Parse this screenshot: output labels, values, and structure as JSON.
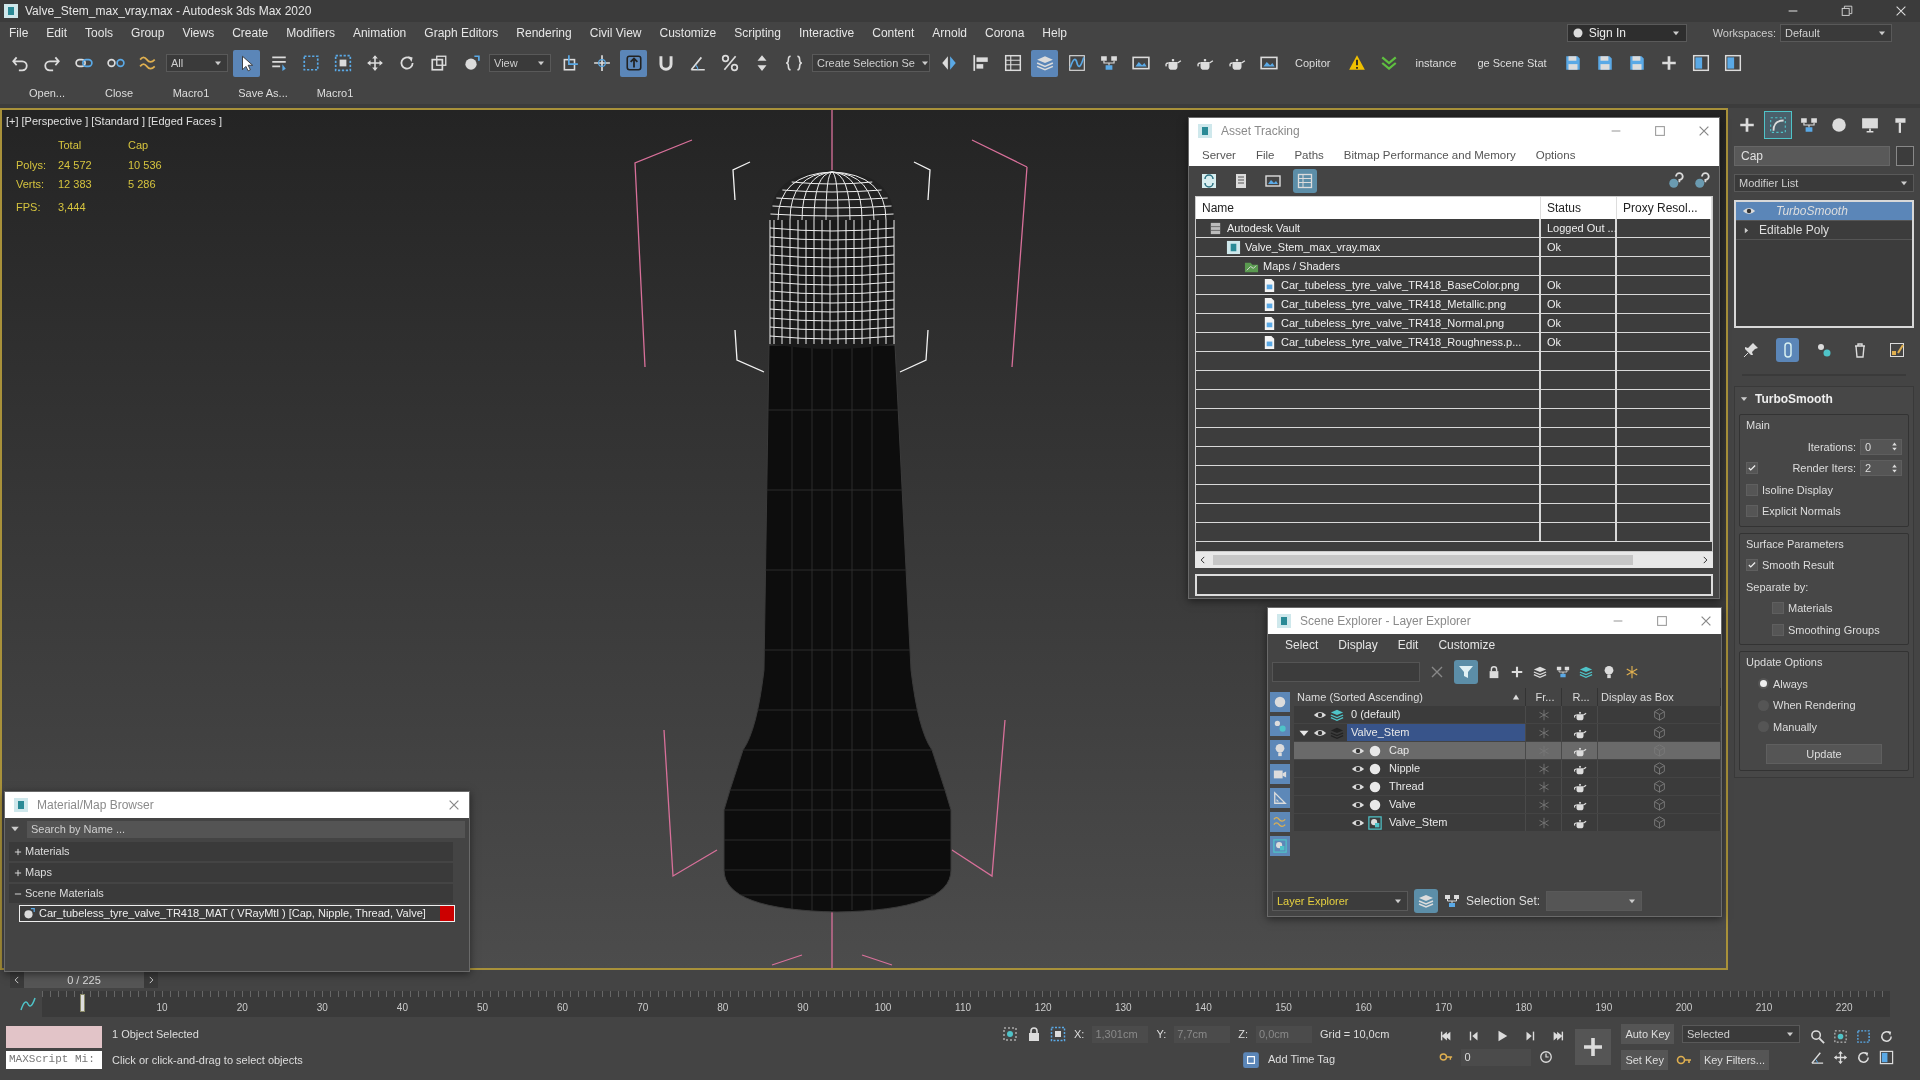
{
  "window": {
    "title": "Valve_Stem_max_vray.max - Autodesk 3ds Max 2020"
  },
  "menu": [
    "File",
    "Edit",
    "Tools",
    "Group",
    "Views",
    "Create",
    "Modifiers",
    "Animation",
    "Graph Editors",
    "Rendering",
    "Civil View",
    "Customize",
    "Scripting",
    "Interactive",
    "Content",
    "Arnold",
    "Corona",
    "Help"
  ],
  "account": {
    "sign_in": "Sign In",
    "workspaces_label": "Workspaces:",
    "workspace": "Default"
  },
  "toolbar": [
    {
      "kind": "button",
      "selected": false
    },
    {
      "kind": "button",
      "selected": false
    },
    {
      "kind": "button",
      "selected": false
    },
    {
      "kind": "button",
      "selected": false
    },
    {
      "kind": "button",
      "selected": false
    },
    {
      "kind": "dropdown",
      "value": "All"
    },
    {
      "kind": "button",
      "selected": true
    },
    {
      "kind": "button",
      "selected": false
    },
    {
      "kind": "button",
      "selected": false
    },
    {
      "kind": "button",
      "selected": false
    },
    {
      "kind": "button",
      "selected": false
    },
    {
      "kind": "button",
      "selected": false
    },
    {
      "kind": "button",
      "selected": false
    },
    {
      "kind": "button",
      "selected": false
    },
    {
      "kind": "dropdown",
      "value": "View"
    },
    {
      "kind": "button",
      "selected": false
    },
    {
      "kind": "button",
      "selected": false
    },
    {
      "kind": "button",
      "selected": true
    },
    {
      "kind": "button",
      "selected": false
    },
    {
      "kind": "button",
      "selected": false
    },
    {
      "kind": "button",
      "selected": false
    },
    {
      "kind": "button",
      "selected": false
    },
    {
      "kind": "button",
      "selected": false
    },
    {
      "kind": "dropdown",
      "value": "Create Selection Se"
    },
    {
      "kind": "button",
      "selected": false
    },
    {
      "kind": "button",
      "selected": false
    },
    {
      "kind": "button",
      "selected": false
    },
    {
      "kind": "button",
      "selected": true
    },
    {
      "kind": "button",
      "selected": false
    },
    {
      "kind": "button",
      "selected": false
    },
    {
      "kind": "button",
      "selected": false
    },
    {
      "kind": "button",
      "selected": false
    },
    {
      "kind": "button",
      "selected": false
    },
    {
      "kind": "button",
      "selected": false
    },
    {
      "kind": "button",
      "selected": false
    },
    {
      "kind": "label",
      "text": "Copitor"
    },
    {
      "kind": "button",
      "selected": false
    },
    {
      "kind": "button",
      "selected": false
    },
    {
      "kind": "label",
      "text": "instance"
    },
    {
      "kind": "label",
      "text": "ge Scene Stat"
    },
    {
      "kind": "button",
      "selected": false
    },
    {
      "kind": "button",
      "selected": false
    },
    {
      "kind": "button",
      "selected": false
    },
    {
      "kind": "button",
      "selected": false
    },
    {
      "kind": "button",
      "selected": false
    },
    {
      "kind": "button",
      "selected": false
    }
  ],
  "macro_bar": [
    "Open...",
    "Close",
    "Macro1",
    "Save As...",
    "Macro1"
  ],
  "viewport": {
    "labels": [
      "[+]",
      "[Perspective ]",
      "[Standard ]",
      "[Edged Faces ]"
    ],
    "stats": {
      "columns": [
        "Total",
        "Cap"
      ],
      "rows": [
        {
          "label": "Polys:",
          "values": [
            "24 572",
            "10 536"
          ]
        },
        {
          "label": "Verts:",
          "values": [
            "12 383",
            "5 286"
          ]
        },
        {
          "label": "FPS:",
          "values": [
            "3,444"
          ]
        }
      ]
    }
  },
  "command_panel": {
    "tabs": [
      {
        "selected": false
      },
      {
        "selected": true
      },
      {
        "selected": false
      },
      {
        "selected": false
      },
      {
        "selected": false
      },
      {
        "selected": false
      }
    ],
    "object_name": "Cap",
    "modifier_list": "Modifier List",
    "stack": [
      {
        "label": "TurboSmooth",
        "selected": true,
        "on": true
      },
      {
        "label": "Editable Poly",
        "selected": false,
        "expanded": false
      }
    ],
    "tools": [
      {
        "selected": false
      },
      {
        "selected": true
      },
      {
        "selected": false
      },
      {
        "selected": false
      },
      {
        "selected": false
      }
    ],
    "rollout": {
      "title": "TurboSmooth",
      "groups": [
        {
          "title": "Main",
          "items": [
            {
              "kind": "spinner",
              "label": "Iterations:",
              "value": "0"
            },
            {
              "kind": "checkspinner",
              "label": "Render Iters:",
              "value": "2",
              "checked": true
            },
            {
              "kind": "checkbox",
              "label": "Isoline Display",
              "checked": false
            },
            {
              "kind": "checkbox",
              "label": "Explicit Normals",
              "checked": false
            }
          ]
        },
        {
          "title": "Surface Parameters",
          "items": [
            {
              "kind": "checkbox",
              "label": "Smooth Result",
              "checked": true
            },
            {
              "kind": "text",
              "label": "Separate by:",
              "children": [
                {
                  "kind": "checkbox",
                  "label": "Materials",
                  "checked": false
                },
                {
                  "kind": "checkbox",
                  "label": "Smoothing Groups",
                  "checked": false
                }
              ]
            }
          ]
        },
        {
          "title": "Update Options",
          "items": [
            {
              "kind": "radio",
              "label": "Always",
              "selected": true
            },
            {
              "kind": "radio",
              "label": "When Rendering",
              "selected": false
            },
            {
              "kind": "radio",
              "label": "Manually",
              "selected": false
            },
            {
              "kind": "button",
              "label": "Update"
            }
          ]
        }
      ]
    }
  },
  "asset_tracking": {
    "title": "Asset Tracking",
    "menu": [
      "Server",
      "File",
      "Paths",
      "Bitmap Performance and Memory",
      "Options"
    ],
    "tools": [
      {
        "selected": false
      },
      {
        "selected": false
      },
      {
        "selected": false
      },
      {
        "selected": true
      }
    ],
    "columns": [
      "Name",
      "Status",
      "Proxy Resol..."
    ],
    "tree": [
      {
        "kind": "vault",
        "name": "Autodesk Vault",
        "status": "Logged Out ...",
        "children": [
          {
            "kind": "scene",
            "name": "Valve_Stem_max_vray.max",
            "status": "Ok",
            "children": [
              {
                "kind": "folder",
                "name": "Maps / Shaders",
                "children": [
                  {
                    "kind": "bitmap",
                    "name": "Car_tubeless_tyre_valve_TR418_BaseColor.png",
                    "status": "Ok"
                  },
                  {
                    "kind": "bitmap",
                    "name": "Car_tubeless_tyre_valve_TR418_Metallic.png",
                    "status": "Ok"
                  },
                  {
                    "kind": "bitmap",
                    "name": "Car_tubeless_tyre_valve_TR418_Normal.png",
                    "status": "Ok"
                  },
                  {
                    "kind": "bitmap",
                    "name": "Car_tubeless_tyre_valve_TR418_Roughness.p...",
                    "status": "Ok"
                  }
                ]
              }
            ]
          }
        ]
      }
    ]
  },
  "scene_explorer": {
    "title": "Scene Explorer - Layer Explorer",
    "menu": [
      "Select",
      "Display",
      "Edit",
      "Customize"
    ],
    "filter_selected": true,
    "side_tools": [
      {
        "selected": true
      },
      {
        "selected": true
      },
      {
        "selected": true
      },
      {
        "selected": true
      },
      {
        "selected": true
      },
      {
        "selected": true
      },
      {
        "selected": true
      }
    ],
    "columns": [
      "Name (Sorted Ascending)",
      "Fr...",
      "R...",
      "Display as Box"
    ],
    "tree": [
      {
        "kind": "layer",
        "name": "0 (default)",
        "selected": false
      },
      {
        "kind": "layer",
        "name": "Valve_Stem",
        "selected": true,
        "expanded": true,
        "children": [
          {
            "kind": "object",
            "name": "Cap",
            "selected": true
          },
          {
            "kind": "object",
            "name": "Nipple",
            "selected": false
          },
          {
            "kind": "object",
            "name": "Thread",
            "selected": false
          },
          {
            "kind": "object",
            "name": "Valve",
            "selected": false
          },
          {
            "kind": "group",
            "name": "Valve_Stem",
            "selected": false
          }
        ]
      }
    ],
    "explorer": "Layer Explorer",
    "selection_set_label": "Selection Set:"
  },
  "material_browser": {
    "title": "Material/Map Browser",
    "search_placeholder": "Search by Name ...",
    "groups": [
      {
        "label": "Materials",
        "expanded": false
      },
      {
        "label": "Maps",
        "expanded": false
      },
      {
        "label": "Scene Materials",
        "expanded": true,
        "items": [
          "Car_tubeless_tyre_valve_TR418_MAT ( VRayMtl ) [Cap, Nipple, Thread, Valve]"
        ]
      }
    ]
  },
  "timeline": {
    "frame": "0 / 225",
    "ticks": [
      "10",
      "20",
      "30",
      "40",
      "50",
      "60",
      "70",
      "80",
      "90",
      "100",
      "110",
      "120",
      "130",
      "140",
      "150",
      "160",
      "170",
      "180",
      "190",
      "200",
      "210",
      "220"
    ]
  },
  "status_bar": {
    "maxscript": "MAXScript Mi:",
    "selection": "1 Object Selected",
    "prompt": "Click or click-and-drag to select objects",
    "coords": [
      {
        "label": "X:",
        "value": "1,301cm",
        "disabled": true
      },
      {
        "label": "Y:",
        "value": "7,7cm",
        "disabled": true
      },
      {
        "label": "Z:",
        "value": "0,0cm",
        "disabled": true
      }
    ],
    "grid": "Grid = 10,0cm",
    "time_tag": "Add Time Tag",
    "frame": "0",
    "auto_key": "Auto Key",
    "key_mode": "Selected",
    "set_key": "Set Key",
    "key_filters": "Key Filters..."
  }
}
